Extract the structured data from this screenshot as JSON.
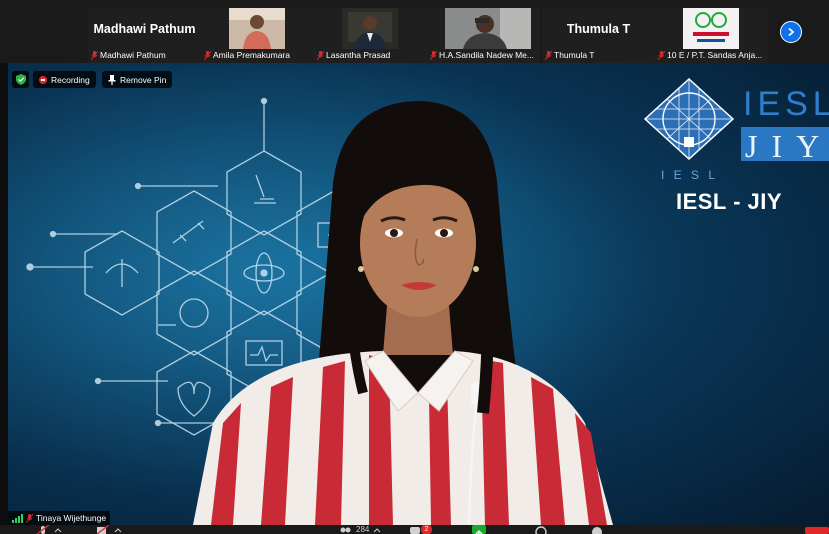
{
  "participants": [
    {
      "display": "name",
      "big_name": "Madhawi Pathum",
      "label": "Madhawi Pathum",
      "muted": true
    },
    {
      "display": "video",
      "label": "Amila Premakumara",
      "muted": true
    },
    {
      "display": "video",
      "label": "Lasantha Prasad",
      "muted": true
    },
    {
      "display": "video",
      "label": "H.A.Sandila Nadew Me...",
      "muted": true
    },
    {
      "display": "name",
      "big_name": "Thumula T",
      "label": "Thumula T",
      "muted": true
    },
    {
      "display": "video",
      "label": "10 E / P.T. Sandas Anja...",
      "muted": true
    }
  ],
  "strip_next_icon": "chevron-right-icon",
  "status": {
    "shield_icon": "shield-check-icon",
    "recording_label": "Recording",
    "remove_pin_label": "Remove Pin"
  },
  "main": {
    "logo_text_top": "IESL",
    "logo_text_bottom": "JIY",
    "logo_under": "I E S L",
    "logo_caption": "IESL - JIY",
    "speaker_name": "Tinaya Wijethunge",
    "speaker_muted": true
  },
  "toolbar": {
    "participants_count": "284",
    "chat_badge": "2"
  },
  "colors": {
    "accent_blue": "#0e71eb",
    "recording_red": "#e02828",
    "share_green": "#1aab2c",
    "muted_red": "#e02828"
  }
}
